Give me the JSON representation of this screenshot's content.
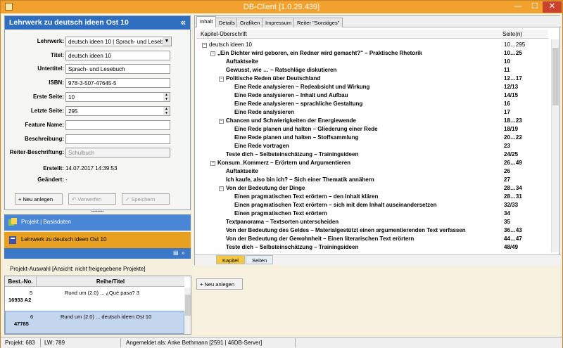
{
  "window": {
    "title": "DB-Client [1.0.29.439]",
    "min": "—",
    "max": "☐",
    "close": "✕"
  },
  "left": {
    "header": "Lehrwerk zu deutsch ideen Ost 10",
    "collapse": "«",
    "fields": {
      "lehrwerk_label": "Lehrwerk:",
      "lehrwerk_value": "deutsch ideen 10 | Sprach- und Lesebuch",
      "titel_label": "Titel:",
      "titel_value": "deutsch ideen 10",
      "untertitel_label": "Untertitel:",
      "untertitel_value": "Sprach- und Lesebuch",
      "isbn_label": "ISBN:",
      "isbn_value": "978-3-507-47645-5",
      "erste_label": "Erste Seite:",
      "erste_value": "10",
      "letzte_label": "Letzte Seite:",
      "letzte_value": "295",
      "feature_label": "Feature Name:",
      "feature_value": "",
      "beschreibung_label": "Beschreibung:",
      "beschreibung_value": "",
      "reiter_label": "Reiter-Beschriftung:",
      "reiter_placeholder": "Schulbuch",
      "erstellt_label": "Erstellt:",
      "erstellt_value": "14.07.2017 14:39:53",
      "geaendert_label": "Geändert:",
      "geaendert_value": "-"
    },
    "buttons": {
      "new": "Neu anlegen",
      "discard": "Verwerfen",
      "save": "Speichern"
    },
    "nav": {
      "projekt": "Projekt | Basisdaten",
      "lehrwerk": "Lehrwerk zu deutsch ideen Ost 10"
    },
    "proj_label": "Projekt-Auswahl [Ansicht: nicht freigegebene Projekte]",
    "table": {
      "col1": "Best.-No.",
      "col2": "Reihe/Titel",
      "rows": [
        {
          "no1": "5",
          "no2": "16933 A2",
          "title": "Rund um (2.0) ... ¿Qué pasa? 3"
        },
        {
          "no1": "6",
          "no2": "47785",
          "title": "Rund um (2.0) ... deutsch ideen Ost 10"
        }
      ]
    }
  },
  "right": {
    "tabs": [
      "Inhalt",
      "Details",
      "Grafiken",
      "Impressum",
      "Reiter \"Sonstiges\""
    ],
    "col_chapter": "Kapitel-Überschrift",
    "col_pages": "Seite(n)",
    "tree": [
      {
        "lvl": 0,
        "exp": "−",
        "text": "deutsch ideen 10",
        "pages": "10…295",
        "bold": false
      },
      {
        "lvl": 1,
        "exp": "−",
        "text": "„Ein Dichter wird geboren, ein Redner wird gemacht?\" – Praktische Rhetorik",
        "pages": "10…25",
        "bold": true
      },
      {
        "lvl": 2,
        "exp": "",
        "text": "Auftaktseite",
        "pages": "10",
        "bold": true
      },
      {
        "lvl": 2,
        "exp": "",
        "text": "Gewusst, wie … – Ratschläge diskutieren",
        "pages": "11",
        "bold": true
      },
      {
        "lvl": 2,
        "exp": "−",
        "text": "Politische Reden über Deutschland",
        "pages": "12…17",
        "bold": true
      },
      {
        "lvl": 3,
        "exp": "",
        "text": "Eine Rede analysieren – Redeabsicht und Wirkung",
        "pages": "12/13",
        "bold": true
      },
      {
        "lvl": 3,
        "exp": "",
        "text": "Eine Rede analysieren – Inhalt und Aufbau",
        "pages": "14/15",
        "bold": true
      },
      {
        "lvl": 3,
        "exp": "",
        "text": "Eine Rede analysieren – sprachliche Gestaltung",
        "pages": "16",
        "bold": true
      },
      {
        "lvl": 3,
        "exp": "",
        "text": "Eine Rede analysieren",
        "pages": "17",
        "bold": true
      },
      {
        "lvl": 2,
        "exp": "−",
        "text": "Chancen und Schwierigkeiten der Energiewende",
        "pages": "18…23",
        "bold": true
      },
      {
        "lvl": 3,
        "exp": "",
        "text": "Eine Rede planen und halten – Gliederung einer Rede",
        "pages": "18/19",
        "bold": true
      },
      {
        "lvl": 3,
        "exp": "",
        "text": "Eine Rede planen und halten – Stoffsammlung",
        "pages": "20…22",
        "bold": true
      },
      {
        "lvl": 3,
        "exp": "",
        "text": "Eine Rede vortragen",
        "pages": "23",
        "bold": true
      },
      {
        "lvl": 2,
        "exp": "",
        "text": "Teste dich – Selbsteinschätzung – Trainingsideen",
        "pages": "24/25",
        "bold": true
      },
      {
        "lvl": 1,
        "exp": "−",
        "text": "Konsum_Kommerz – Erörtern und Argumentieren",
        "pages": "26…49",
        "bold": true
      },
      {
        "lvl": 2,
        "exp": "",
        "text": "Auftaktseite",
        "pages": "26",
        "bold": true
      },
      {
        "lvl": 2,
        "exp": "",
        "text": "Ich kaufe, also bin ich? – Sich einer Thematik annähern",
        "pages": "27",
        "bold": true
      },
      {
        "lvl": 2,
        "exp": "−",
        "text": "Von der Bedeutung der Dinge",
        "pages": "28…34",
        "bold": true
      },
      {
        "lvl": 3,
        "exp": "",
        "text": "Einen pragmatischen Text erörtern – den Inhalt klären",
        "pages": "28…31",
        "bold": true
      },
      {
        "lvl": 3,
        "exp": "",
        "text": "Einen pragmatischen Text erörtern – sich mit dem Inhalt auseinandersetzen",
        "pages": "32/33",
        "bold": true
      },
      {
        "lvl": 3,
        "exp": "",
        "text": "Einen pragmatischen Text erörtern",
        "pages": "34",
        "bold": true
      },
      {
        "lvl": 2,
        "exp": "",
        "text": "Textpanorama – Textsorten unterscheiden",
        "pages": "35",
        "bold": true
      },
      {
        "lvl": 2,
        "exp": "",
        "text": "Von der Bedeutung des Geldes – Materialgestützt einen argumentierenden Text verfassen",
        "pages": "36…43",
        "bold": true
      },
      {
        "lvl": 2,
        "exp": "",
        "text": "Von der Bedeutung der Gewohnheit – Einen literarischen Text erörtern",
        "pages": "44…47",
        "bold": true
      },
      {
        "lvl": 2,
        "exp": "",
        "text": "Teste dich – Selbsteinschätzung – Trainingsideen",
        "pages": "48/49",
        "bold": true
      }
    ],
    "btabs": [
      "Kapitel",
      "Seiten"
    ],
    "new_button": "Neu anlegen"
  },
  "status": {
    "projekt": "Projekt: 683",
    "lw": "LW: 789",
    "user": "Angemeldet als: Anke Bethmann [2591 | 46DB-Server]"
  }
}
